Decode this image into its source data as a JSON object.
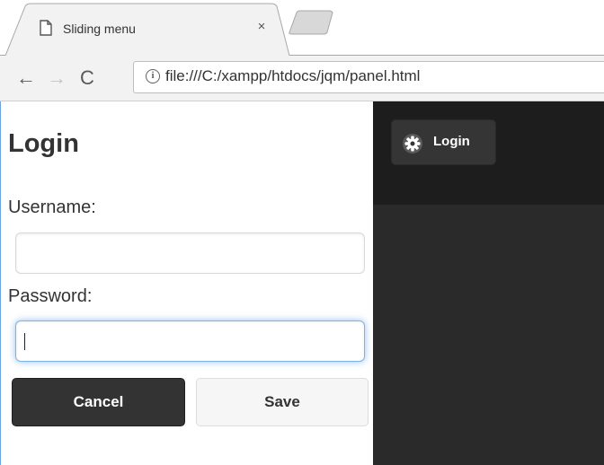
{
  "browser": {
    "tab_title": "Sliding menu",
    "tab_close": "×",
    "url": "file:///C:/xampp/htdocs/jqm/panel.html",
    "nav": {
      "back": "←",
      "forward": "→",
      "reload": "C"
    },
    "info": "i"
  },
  "panel": {
    "heading": "Login",
    "username_label": "Username:",
    "username_value": "",
    "password_label": "Password:",
    "password_value": "",
    "cancel_label": "Cancel",
    "save_label": "Save"
  },
  "content": {
    "toggle_label": "Login"
  },
  "colors": {
    "content_bg": "#2a2a2a",
    "header_bg": "#1d1d1d",
    "cancel_bg": "#333333",
    "focus_glow": "#388ce6"
  }
}
